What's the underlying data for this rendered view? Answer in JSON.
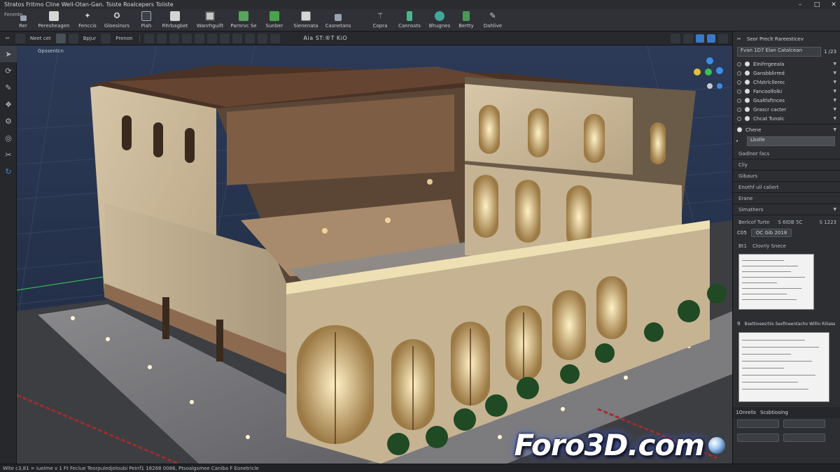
{
  "titlebar": {
    "title": "Stratos Fritmo Cline  Well-Otan-Gan.  Tsiste  Roalcepers  Toliste"
  },
  "ribbon": {
    "left_label": "Fenmte",
    "items": [
      {
        "label": "Rer",
        "icon": "menu-icon",
        "color": "#9aa3ad"
      },
      {
        "label": "Peresheagen",
        "icon": "document-icon",
        "color": "#d6d6d6"
      },
      {
        "label": "Fenccis",
        "icon": "sparkle-icon",
        "color": "#cfd3d8"
      },
      {
        "label": "Gloesinsrs",
        "icon": "select-icon",
        "color": "#cfd3d8"
      },
      {
        "label": "Piah",
        "icon": "move-icon",
        "color": "#cfd3d8"
      },
      {
        "label": "Rhrbagbet",
        "icon": "window-icon",
        "color": "#d4d4d4"
      },
      {
        "label": "Wanrhguift",
        "icon": "portrait-icon",
        "color": "#d4d4d4"
      },
      {
        "label": "Parnrvc Se",
        "icon": "wall-icon",
        "color": "#5aa35a"
      },
      {
        "label": "Sunber",
        "icon": "render-icon",
        "color": "#49a34b"
      },
      {
        "label": "Sienenata",
        "icon": "cube-icon",
        "color": "#d6d6d6"
      },
      {
        "label": "Casnetans",
        "icon": "grid-icon",
        "color": "#9aa3ad"
      },
      {
        "label": "Copra",
        "icon": "share-icon",
        "color": "#cfd3d8"
      },
      {
        "label": "Cannssts",
        "icon": "bottle-icon",
        "color": "#4bb58d"
      },
      {
        "label": "Bhugnes",
        "icon": "globe-icon",
        "color": "#3fa89a"
      },
      {
        "label": "Bertty",
        "icon": "sheet-icon",
        "color": "#4a9a55"
      },
      {
        "label": "Dahlive",
        "icon": "pen-icon",
        "color": "#cfd3d8"
      }
    ]
  },
  "toolbar2": {
    "items": [
      "Neet cet",
      "Bpjur",
      "Prenon"
    ],
    "coordinate": "Aia  ST:®T KiO"
  },
  "viewport": {
    "label": "Gpssentcn"
  },
  "watermark": {
    "text": "Foro3D.com"
  },
  "rpanel": {
    "header": "Seor Preclt  Rareesticev",
    "search_value": "Fvan 1D7 Elan Catalcean",
    "search_count": "1 /23",
    "layers": [
      "Elnifrrgeeala",
      "Gansbblirred",
      "Chlstrlcllerec",
      "Fancoolfolki",
      "Gsaltlsftnces",
      "Grascr cacter",
      "Chcat Tunolc"
    ],
    "section": "Chene",
    "section_field": "Lbolle",
    "rows": [
      "Gadlnor facs",
      "Cliy",
      "Gibaurs",
      "Enothf ull caliert",
      "Erane",
      "Slmathers"
    ],
    "coords_label": "Berlcof Turte",
    "coords_value": "S 6IDB 5C",
    "coords_right": "S 1223",
    "tab_a": "C05",
    "tab_b": "OC  Gib 2018",
    "list_title": "Clovrly Snece",
    "list_num": "Bt1",
    "item_num": "9",
    "item_text": "Bsettiosesrtiis  Sexfineentacho Willin Riliasert",
    "footer_a": "1Onrells",
    "footer_b": "Scsbtiosing"
  },
  "status": {
    "text": "Wlte c3,81 =   Iuelme   v 1   Ft Feclue   Teorpuledjeloubi Peinf1  18268 0086,  Ptsoalgsmee  Caniba F Eonetricle"
  }
}
